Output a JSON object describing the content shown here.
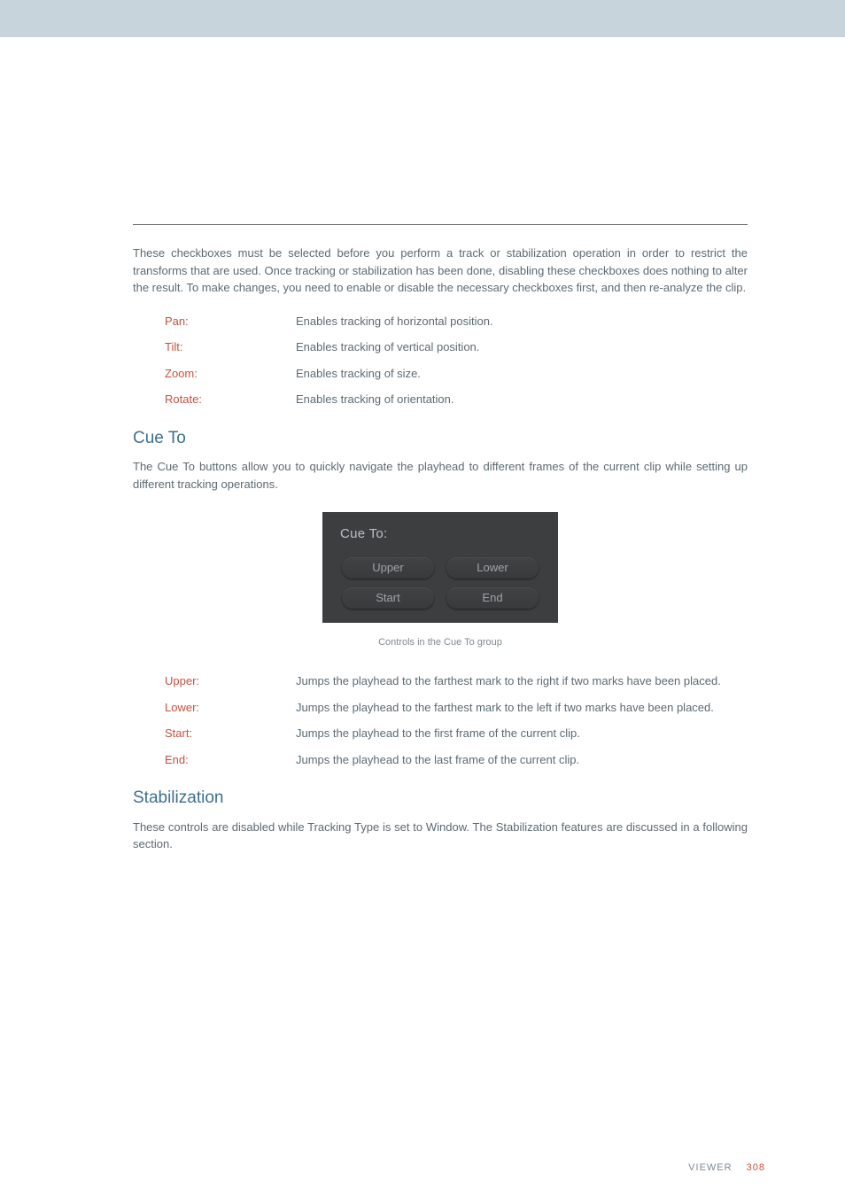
{
  "intro_para": "These checkboxes must be selected before you perform a track or stabilization operation in order to restrict the transforms that are used. Once tracking or stabilization has been done, disabling these checkboxes does nothing to alter the result. To make changes, you need to enable or disable the necessary checkboxes first, and then re-analyze the clip.",
  "tracking_defs": {
    "pan": {
      "term": "Pan:",
      "desc": "Enables tracking of horizontal position."
    },
    "tilt": {
      "term": "Tilt:",
      "desc": "Enables tracking of vertical position."
    },
    "zoom": {
      "term": "Zoom:",
      "desc": "Enables tracking of size."
    },
    "rotate": {
      "term": "Rotate:",
      "desc": "Enables tracking of orientation."
    }
  },
  "cue_to": {
    "heading": "Cue To",
    "para": "The Cue To buttons allow you to quickly navigate the playhead to different frames of the current clip while setting up different tracking operations.",
    "panel_title": "Cue To:",
    "buttons": {
      "upper": "Upper",
      "lower": "Lower",
      "start": "Start",
      "end": "End"
    },
    "caption": "Controls in the Cue To group",
    "defs": {
      "upper": {
        "term": "Upper:",
        "desc": "Jumps the playhead to the farthest mark to the right if two marks have been placed."
      },
      "lower": {
        "term": "Lower:",
        "desc": "Jumps the playhead to the farthest mark to the left if two marks have been placed."
      },
      "start": {
        "term": "Start:",
        "desc": "Jumps the playhead to the first frame of the current clip."
      },
      "end": {
        "term": "End:",
        "desc": "Jumps the playhead to the last frame of the current clip."
      }
    }
  },
  "stabilization": {
    "heading": "Stabilization",
    "para": "These controls are disabled while Tracking Type is set to Window. The Stabilization features are discussed in a following section."
  },
  "footer": {
    "section": "VIEWER",
    "page": "308"
  }
}
